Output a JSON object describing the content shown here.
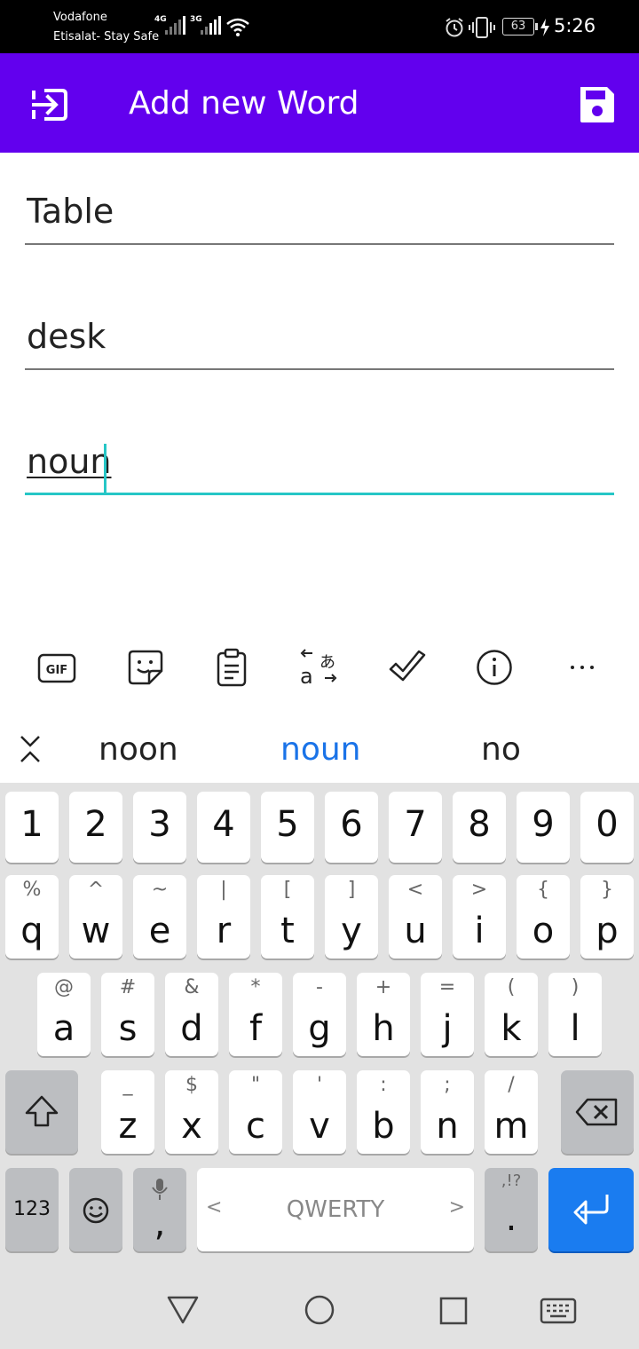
{
  "status": {
    "carrier1": "Vodafone",
    "carrier2": "Etisalat- Stay Safe",
    "network1": "4G",
    "network2": "3G",
    "battery": "63",
    "time": "5:26"
  },
  "appbar": {
    "title": "Add new Word",
    "color": "#6200EE"
  },
  "fields": {
    "word": "Table",
    "translation": "desk",
    "type": "noun"
  },
  "suggestions": [
    "noon",
    "noun",
    "no"
  ],
  "keyboard": {
    "numbers": [
      "1",
      "2",
      "3",
      "4",
      "5",
      "6",
      "7",
      "8",
      "9",
      "0"
    ],
    "row1": [
      {
        "k": "q",
        "s": "%"
      },
      {
        "k": "w",
        "s": "^"
      },
      {
        "k": "e",
        "s": "~"
      },
      {
        "k": "r",
        "s": "|"
      },
      {
        "k": "t",
        "s": "["
      },
      {
        "k": "y",
        "s": "]"
      },
      {
        "k": "u",
        "s": "<"
      },
      {
        "k": "i",
        "s": ">"
      },
      {
        "k": "o",
        "s": "{"
      },
      {
        "k": "p",
        "s": "}"
      }
    ],
    "row2": [
      {
        "k": "a",
        "s": "@"
      },
      {
        "k": "s",
        "s": "#"
      },
      {
        "k": "d",
        "s": "&"
      },
      {
        "k": "f",
        "s": "*"
      },
      {
        "k": "g",
        "s": "-"
      },
      {
        "k": "h",
        "s": "+"
      },
      {
        "k": "j",
        "s": "="
      },
      {
        "k": "k",
        "s": "("
      },
      {
        "k": "l",
        "s": ")"
      }
    ],
    "row3": [
      {
        "k": "z",
        "s": "_"
      },
      {
        "k": "x",
        "s": "$"
      },
      {
        "k": "c",
        "s": "\""
      },
      {
        "k": "v",
        "s": "'"
      },
      {
        "k": "b",
        "s": ":"
      },
      {
        "k": "n",
        "s": ";"
      },
      {
        "k": "m",
        "s": "/"
      }
    ],
    "sym_label": "123",
    "comma": ",",
    "space_label": "QWERTY",
    "space_left": "<",
    "space_right": ">",
    "period": ".",
    "period_sub": ",!?"
  }
}
